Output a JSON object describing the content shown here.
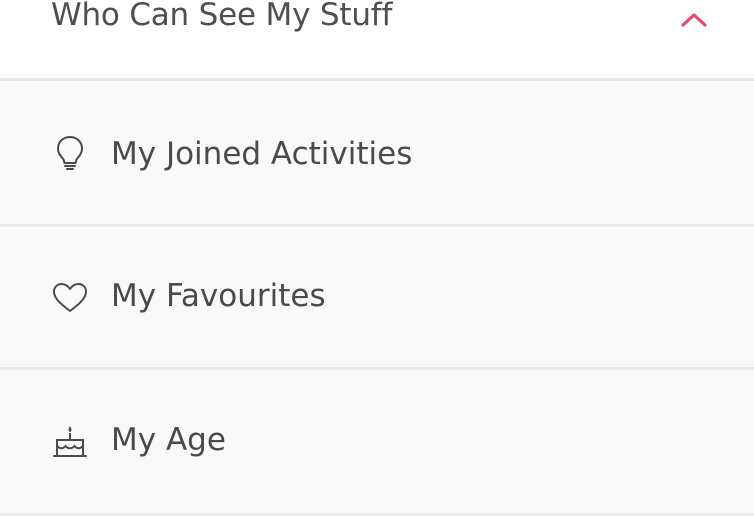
{
  "section": {
    "title": "Who Can See My Stuff",
    "toggle_icon": "chevron-up-icon",
    "accent_color": "#e8476f"
  },
  "items": [
    {
      "label": "My Joined Activities",
      "icon": "lightbulb-icon"
    },
    {
      "label": "My Favourites",
      "icon": "heart-icon"
    },
    {
      "label": "My Age",
      "icon": "birthday-cake-icon"
    }
  ],
  "colors": {
    "text": "#4a4a4a",
    "list_background": "#f9f9f9",
    "divider": "#e9e9e9"
  }
}
